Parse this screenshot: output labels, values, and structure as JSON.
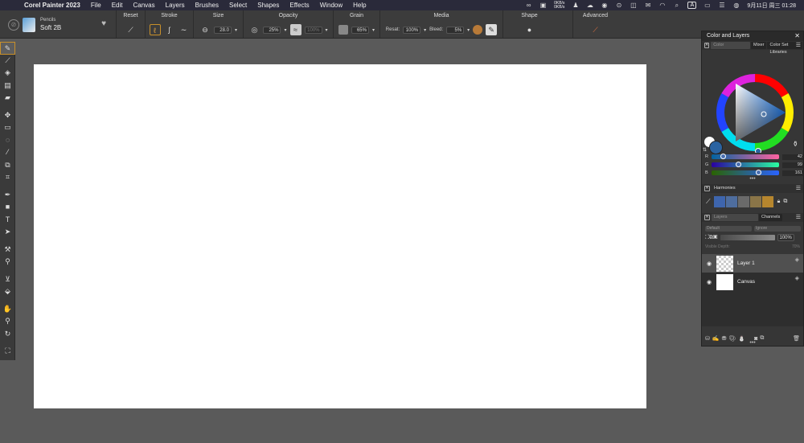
{
  "menubar": {
    "app_name": "Corel Painter 2023",
    "items": [
      "File",
      "Edit",
      "Canvas",
      "Layers",
      "Brushes",
      "Select",
      "Shapes",
      "Effects",
      "Window",
      "Help"
    ],
    "net_up": "0KB/s",
    "net_down": "0KB/s",
    "input_indicator": "A",
    "datetime": "9月11日 周三  01:28"
  },
  "propbar": {
    "brush_category": "Pencils",
    "brush_variant": "Soft 2B",
    "reset_label": "Reset",
    "stroke_label": "Stroke",
    "size_label": "Size",
    "size_value": "28.0",
    "opacity_label": "Opacity",
    "opacity_value": "25%",
    "opacity_value2": "100%",
    "grain_label": "Grain",
    "grain_value": "65%",
    "media_label": "Media",
    "resat_label": "Resat:",
    "resat_value": "100%",
    "bleed_label": "Bleed:",
    "bleed_value": "5%",
    "shape_label": "Shape",
    "advanced_label": "Advanced"
  },
  "panel": {
    "title": "Color and Layers",
    "color_tabs": [
      "Color",
      "Mixer",
      "Color Set Libraries"
    ],
    "rgb": [
      {
        "label": "R",
        "value": "42"
      },
      {
        "label": "G",
        "value": "99"
      },
      {
        "label": "B",
        "value": "161"
      }
    ],
    "current_color": "#2a63a1",
    "harmonies_tab": "Harmonies",
    "harmony_colors": [
      "#3e65ad",
      "#4e6d9e",
      "#6a6a6a",
      "#8a7548",
      "#b6862e"
    ],
    "layers_tabs": [
      "Layers",
      "Channels"
    ],
    "composite_method": "Default",
    "composite_depth": "Ignore",
    "opacity": "100%",
    "visible_depth_label": "Visible Depth:",
    "visible_depth_value": "70%",
    "layers": [
      {
        "name": "Layer 1",
        "selected": true
      },
      {
        "name": "Canvas",
        "selected": false
      }
    ]
  }
}
